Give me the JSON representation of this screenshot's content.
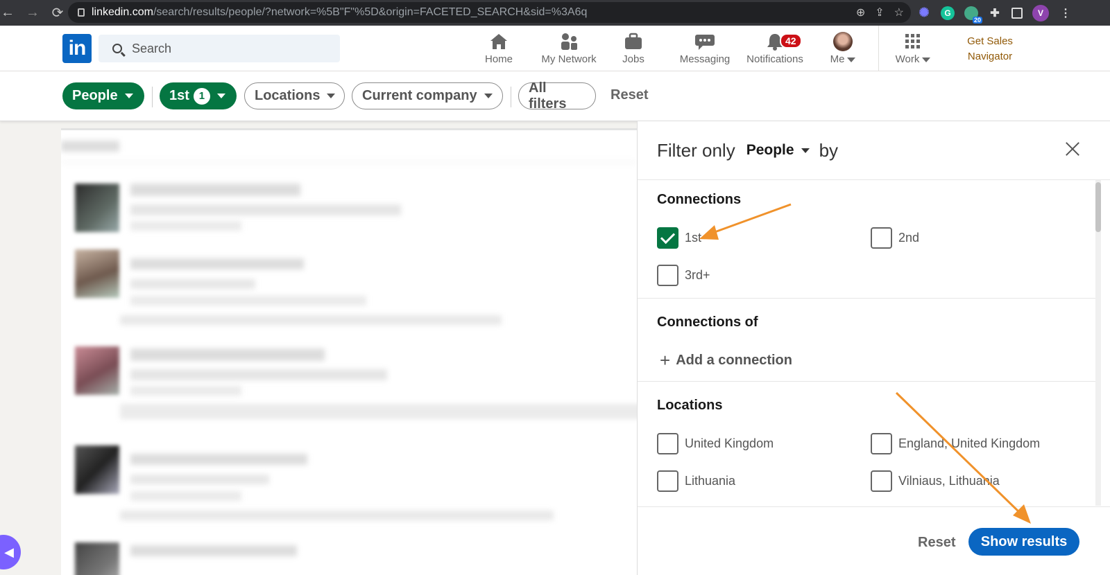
{
  "browser": {
    "url_host": "linkedin.com",
    "url_rest": "/search/results/people/?network=%5B\"F\"%5D&origin=FACETED_SEARCH&sid=%3A6q",
    "ext_badge": "20",
    "profile_initial": "V"
  },
  "header": {
    "search_placeholder": "Search",
    "nav": [
      {
        "label": "Home"
      },
      {
        "label": "My Network"
      },
      {
        "label": "Jobs"
      },
      {
        "label": "Messaging"
      },
      {
        "label": "Notifications",
        "badge": "42"
      },
      {
        "label": "Me"
      },
      {
        "label": "Work"
      }
    ],
    "sales_line1": "Get Sales",
    "sales_line2": "Navigator"
  },
  "filters": {
    "people": "People",
    "first": "1st",
    "first_count": "1",
    "locations": "Locations",
    "current_company": "Current company",
    "all_filters": "All filters",
    "reset": "Reset"
  },
  "panel": {
    "title_prefix": "Filter only",
    "title_select": "People",
    "title_suffix": "by",
    "connections_heading": "Connections",
    "connections": [
      {
        "label": "1st",
        "checked": true
      },
      {
        "label": "2nd",
        "checked": false
      },
      {
        "label": "3rd+",
        "checked": false
      }
    ],
    "connections_of_heading": "Connections of",
    "add_connection": "Add a connection",
    "locations_heading": "Locations",
    "locations": [
      {
        "label": "United Kingdom",
        "checked": false
      },
      {
        "label": "England, United Kingdom",
        "checked": false
      },
      {
        "label": "Lithuania",
        "checked": false
      },
      {
        "label": "Vilniaus, Lithuania",
        "checked": false
      }
    ],
    "reset": "Reset",
    "show_results": "Show results"
  },
  "colors": {
    "linkedin_blue": "#0a66c2",
    "filter_green": "#057642",
    "annotation_orange": "#f0922b",
    "notification_red": "#cc1016"
  }
}
